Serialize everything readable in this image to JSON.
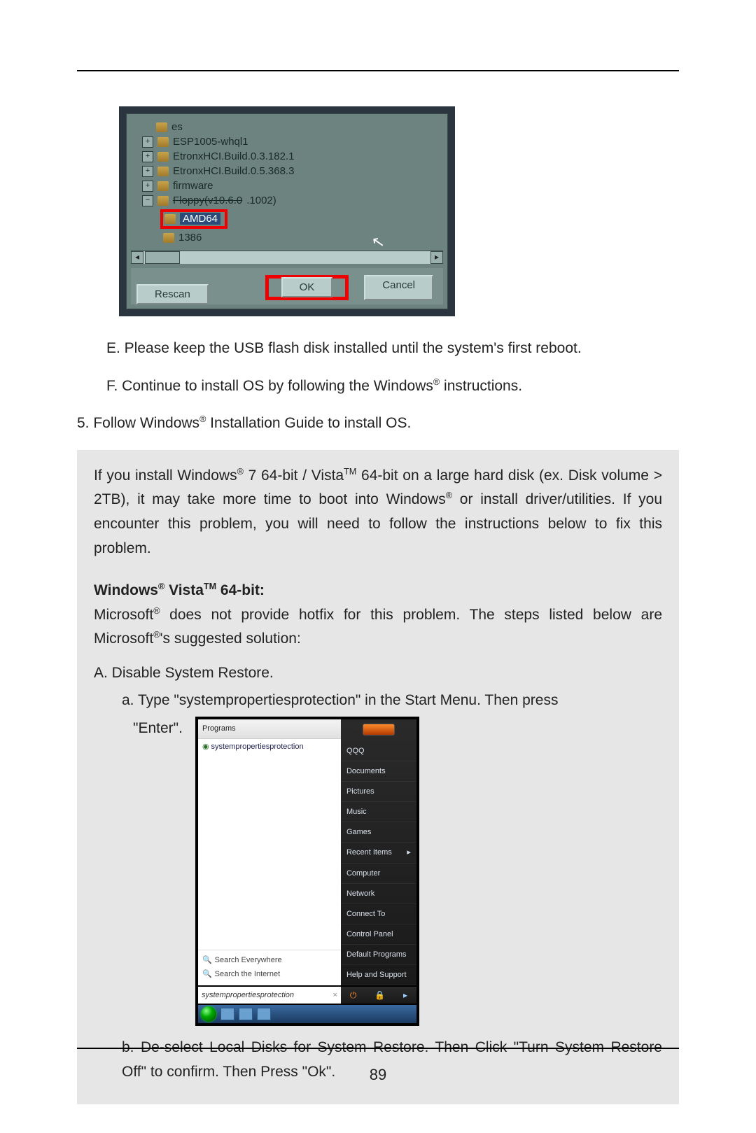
{
  "page_number": "89",
  "fig1": {
    "tree": {
      "row0": "es",
      "row1": "ESP1005-whql1",
      "row2": "EtronxHCI.Build.0.3.182.1",
      "row3": "EtronxHCI.Build.0.5.368.3",
      "row4": "firmware",
      "row5_strike": "Floppy(v10.6.0",
      "row5_tail": ".1002)",
      "amd64": "AMD64",
      "i386": "1386"
    },
    "ok": "OK",
    "cancel": "Cancel",
    "rescan": "Rescan"
  },
  "body": {
    "e": "E. Please keep the USB flash disk installed until the system's first reboot.",
    "f_pre": "F. Continue to install OS by following the Windows",
    "f_post": " instructions.",
    "p5_pre": "5. Follow Windows",
    "p5_post": " Installation Guide to install OS.",
    "reg": "®"
  },
  "note": {
    "p1_a": "If you install Windows",
    "p1_b": " 7 64-bit / Vista",
    "p1_c": " 64-bit on a large hard disk (ex. Disk volume > 2TB), it may take more time to boot into Windows",
    "p1_d": " or install driver/utilities. If you encounter this problem, you will need to follow the instructions below to fix this problem.",
    "tm": "TM",
    "heading_a": "Windows",
    "heading_b": " Vista",
    "heading_c": " 64-bit:",
    "p2_a": "Microsoft",
    "p2_b": " does not provide hotfix for this problem. The steps listed below are Microsoft",
    "p2_c": "'s suggested solution:",
    "A": "A. Disable System Restore.",
    "a_sub": "a. Type \"systempropertiesprotection\" in the Start Menu. Then press",
    "a_enter": "\"Enter\".",
    "b_sub": "b. De-select Local Disks for System Restore. Then Click \"Turn System Restore Off\" to confirm. Then Press \"Ok\"."
  },
  "fig2": {
    "programs_label": "Programs",
    "result_item": "systempropertiesprotection",
    "search_everywhere": "Search Everywhere",
    "search_internet": "Search the Internet",
    "right_items": [
      "QQQ",
      "Documents",
      "Pictures",
      "Music",
      "Games",
      "Recent Items",
      "Computer",
      "Network",
      "Connect To",
      "Control Panel",
      "Default Programs",
      "Help and Support"
    ],
    "searchbox_value": "systempropertiesprotection",
    "close_x": "×",
    "arrow": "▸"
  }
}
